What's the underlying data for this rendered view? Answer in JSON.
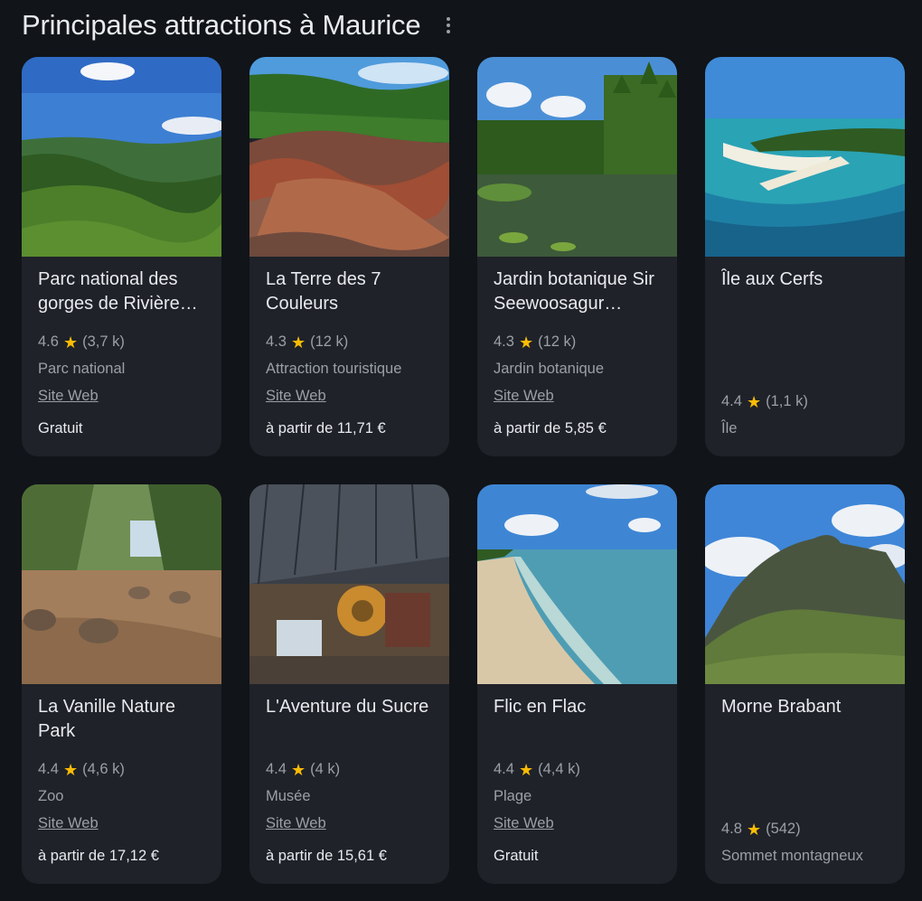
{
  "header": {
    "title": "Principales attractions à Maurice"
  },
  "cards": [
    {
      "name": "Parc national des gorges de Rivière…",
      "rating": "4.6",
      "count": "(3,7 k)",
      "category": "Parc national",
      "link": "Site Web",
      "price": "Gratuit"
    },
    {
      "name": "La Terre des 7 Couleurs",
      "rating": "4.3",
      "count": "(12 k)",
      "category": "Attraction touristique",
      "link": "Site Web",
      "price": "à partir de 11,71 €"
    },
    {
      "name": "Jardin botanique Sir Seewoosagur…",
      "rating": "4.3",
      "count": "(12 k)",
      "category": "Jardin botanique",
      "link": "Site Web",
      "price": "à partir de 5,85 €"
    },
    {
      "name": "Île aux Cerfs",
      "rating": "4.4",
      "count": "(1,1 k)",
      "category": "Île"
    },
    {
      "name": "La Vanille Nature Park",
      "rating": "4.4",
      "count": "(4,6 k)",
      "category": "Zoo",
      "link": "Site Web",
      "price": "à partir de 17,12 €"
    },
    {
      "name": "L'Aventure du Sucre",
      "rating": "4.4",
      "count": "(4 k)",
      "category": "Musée",
      "link": "Site Web",
      "price": "à partir de 15,61 €"
    },
    {
      "name": "Flic en Flac",
      "rating": "4.4",
      "count": "(4,4 k)",
      "category": "Plage",
      "link": "Site Web",
      "price": "Gratuit"
    },
    {
      "name": "Morne Brabant",
      "rating": "4.8",
      "count": "(542)",
      "category": "Sommet montagneux"
    }
  ]
}
